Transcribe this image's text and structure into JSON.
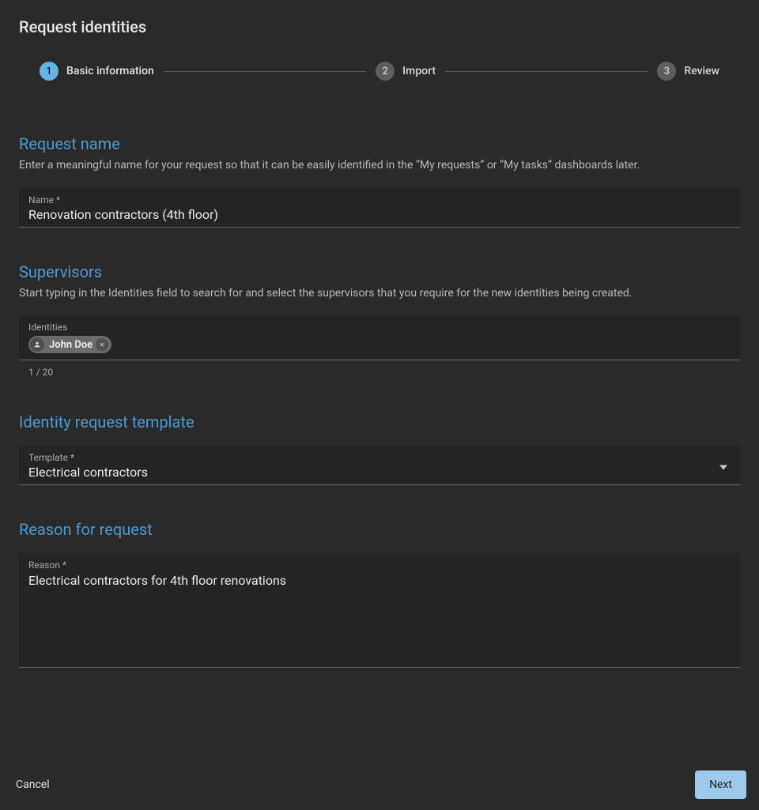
{
  "header": {
    "title": "Request identities"
  },
  "stepper": {
    "steps": [
      {
        "num": "1",
        "label": "Basic information"
      },
      {
        "num": "2",
        "label": "Import"
      },
      {
        "num": "3",
        "label": "Review"
      }
    ]
  },
  "sections": {
    "requestName": {
      "title": "Request name",
      "desc": "Enter a meaningful name for your request so that it can be easily identified in the “My requests” or “My tasks” dashboards later.",
      "fieldLabel": "Name *",
      "value": "Renovation contractors (4th floor)"
    },
    "supervisors": {
      "title": "Supervisors",
      "desc": "Start typing in the Identities field to search for and select the supervisors that you require for the new identities being created.",
      "fieldLabel": "Identities",
      "chips": [
        {
          "name": "John Doe"
        }
      ],
      "count": "1 / 20"
    },
    "template": {
      "title": "Identity request template",
      "fieldLabel": "Template *",
      "value": "Electrical contractors"
    },
    "reason": {
      "title": "Reason for request",
      "fieldLabel": "Reason *",
      "value": "Electrical contractors for 4th floor renovations"
    }
  },
  "footer": {
    "cancel": "Cancel",
    "next": "Next"
  }
}
